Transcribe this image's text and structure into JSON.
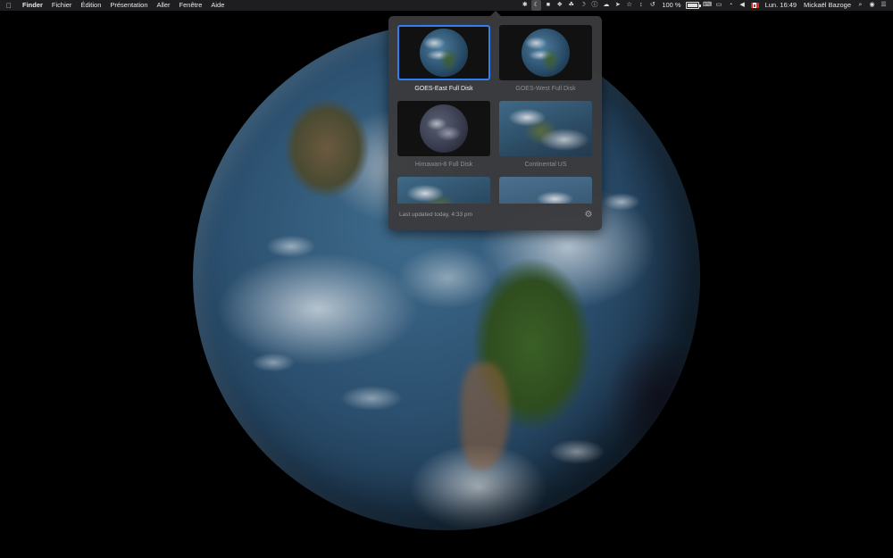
{
  "menubar": {
    "app_name": "Finder",
    "menus": [
      "Fichier",
      "Édition",
      "Présentation",
      "Aller",
      "Fenêtre",
      "Aide"
    ],
    "battery_percent": "100 %",
    "clock": "Lun. 16:49",
    "user": "Mickaël Bazoge",
    "status_icons": [
      "bluetooth-icon",
      "downlink-icon",
      "chat-icon",
      "dropbox-icon",
      "evernote-icon",
      "moon-icon",
      "info-icon",
      "cloud-icon",
      "bird-icon",
      "fantastical-icon",
      "network-icon",
      "time-machine-icon",
      "battery-icon",
      "keyboard-icon",
      "airplay-icon",
      "wifi-icon",
      "volume-icon",
      "flag-icon",
      "spotlight-icon",
      "siri-icon",
      "notification-center-icon"
    ]
  },
  "popover": {
    "items": [
      {
        "label": "GOES-East Full Disk",
        "selected": true,
        "kind": "disk"
      },
      {
        "label": "GOES-West Full Disk",
        "selected": false,
        "kind": "disk"
      },
      {
        "label": "Himawari-8 Full Disk",
        "selected": false,
        "kind": "disk-dark"
      },
      {
        "label": "Continental US",
        "selected": false,
        "kind": "regional"
      },
      {
        "label": "",
        "selected": false,
        "kind": "regional"
      },
      {
        "label": "",
        "selected": false,
        "kind": "regional-b"
      }
    ],
    "footer": "Last updated today, 4:33 pm"
  },
  "colors": {
    "accent": "#2f7ff2",
    "popover_bg": "#3a3a3c",
    "menubar_bg": "#1e1e20"
  }
}
